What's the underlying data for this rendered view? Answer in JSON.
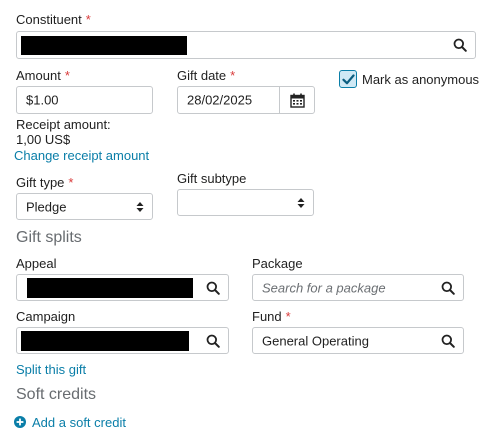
{
  "constituent": {
    "label": "Constituent"
  },
  "amount": {
    "label": "Amount",
    "value": "$1.00"
  },
  "receipt": {
    "label": "Receipt amount:",
    "value": "1,00 US$",
    "change_link": "Change receipt amount"
  },
  "gift_date": {
    "label": "Gift date",
    "value": "28/02/2025"
  },
  "anonymous": {
    "label": "Mark as anonymous",
    "checked": true
  },
  "gift_type": {
    "label": "Gift type",
    "value": "Pledge"
  },
  "gift_subtype": {
    "label": "Gift subtype",
    "value": ""
  },
  "gift_splits": {
    "title": "Gift splits"
  },
  "appeal": {
    "label": "Appeal"
  },
  "package": {
    "label": "Package",
    "placeholder": "Search for a package"
  },
  "campaign": {
    "label": "Campaign"
  },
  "fund": {
    "label": "Fund",
    "value": "General Operating"
  },
  "split_link": "Split this gift",
  "soft_credits": {
    "title": "Soft credits",
    "add_label": "Add a soft credit"
  },
  "colors": {
    "accent": "#0a7ea8",
    "required": "#d93a3a",
    "checkbox_bg": "#cfe9f5"
  }
}
